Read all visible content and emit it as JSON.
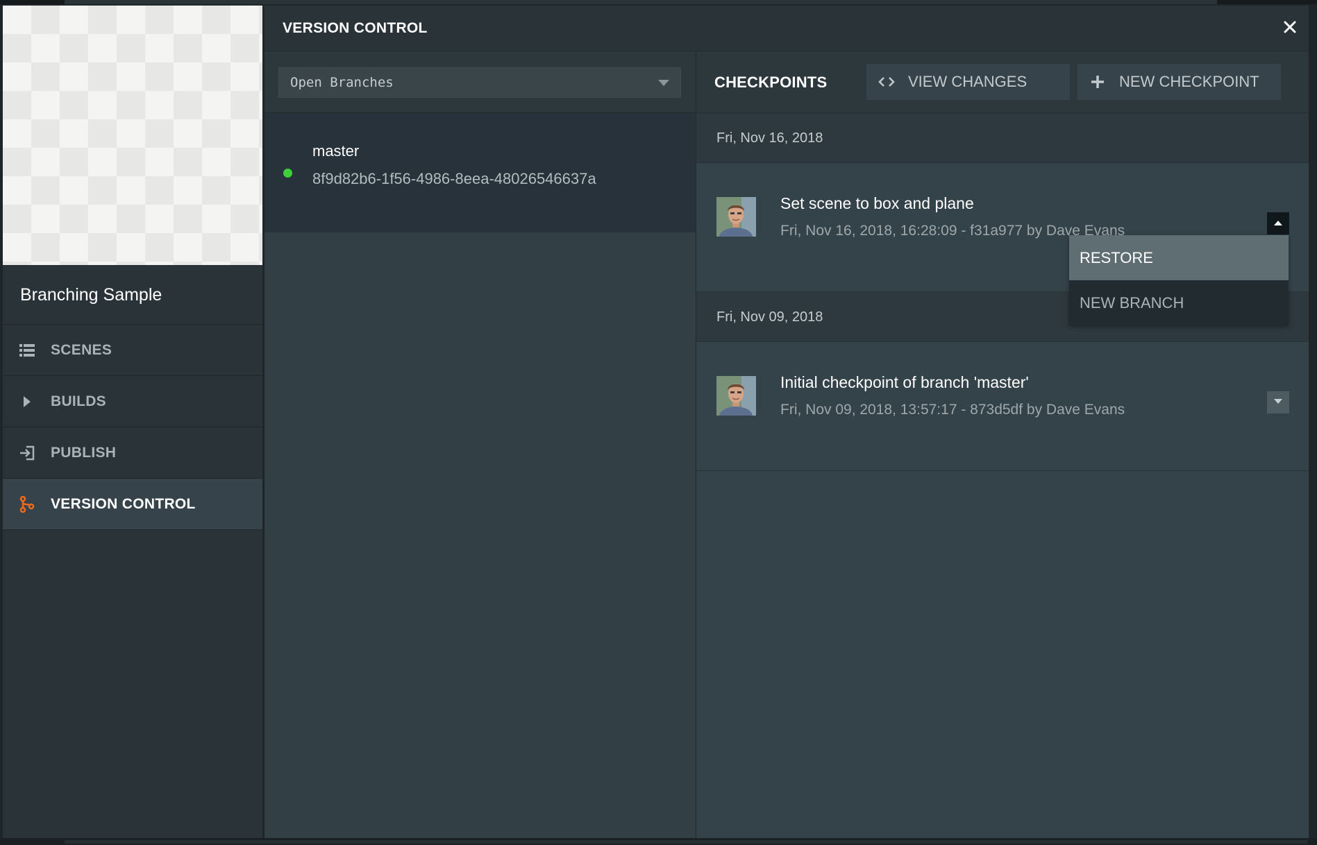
{
  "sidebar": {
    "project_name": "Branching Sample",
    "items": [
      {
        "label": "SCENES",
        "icon": "list-icon",
        "active": false
      },
      {
        "label": "BUILDS",
        "icon": "play-icon",
        "active": false
      },
      {
        "label": "PUBLISH",
        "icon": "publish-icon",
        "active": false
      },
      {
        "label": "VERSION CONTROL",
        "icon": "branch-icon",
        "active": true
      }
    ]
  },
  "header": {
    "title": "VERSION CONTROL",
    "close_icon": "close-icon"
  },
  "branches": {
    "filter_value": "Open Branches",
    "items": [
      {
        "name": "master",
        "id": "8f9d82b6-1f56-4986-8eea-48026546637a",
        "status_color": "#3ecf3a"
      }
    ]
  },
  "checkpoints": {
    "title": "CHECKPOINTS",
    "view_changes_label": "VIEW CHANGES",
    "new_checkpoint_label": "NEW CHECKPOINT",
    "groups": [
      {
        "date": "Fri, Nov 16, 2018",
        "items": [
          {
            "title": "Set scene to box and plane",
            "meta": "Fri, Nov 16, 2018, 16:28:09 - f31a977 by Dave Evans",
            "expanded": true
          }
        ]
      },
      {
        "date": "Fri, Nov 09, 2018",
        "items": [
          {
            "title": "Initial checkpoint of branch 'master'",
            "meta": "Fri, Nov 09, 2018, 13:57:17 - 873d5df by Dave Evans",
            "expanded": false
          }
        ]
      }
    ]
  },
  "context_menu": {
    "items": [
      {
        "label": "RESTORE",
        "highlighted": true
      },
      {
        "label": "NEW BRANCH",
        "highlighted": false
      }
    ]
  },
  "colors": {
    "accent_orange": "#f26b1d",
    "active_dot": "#3ecf3a"
  }
}
